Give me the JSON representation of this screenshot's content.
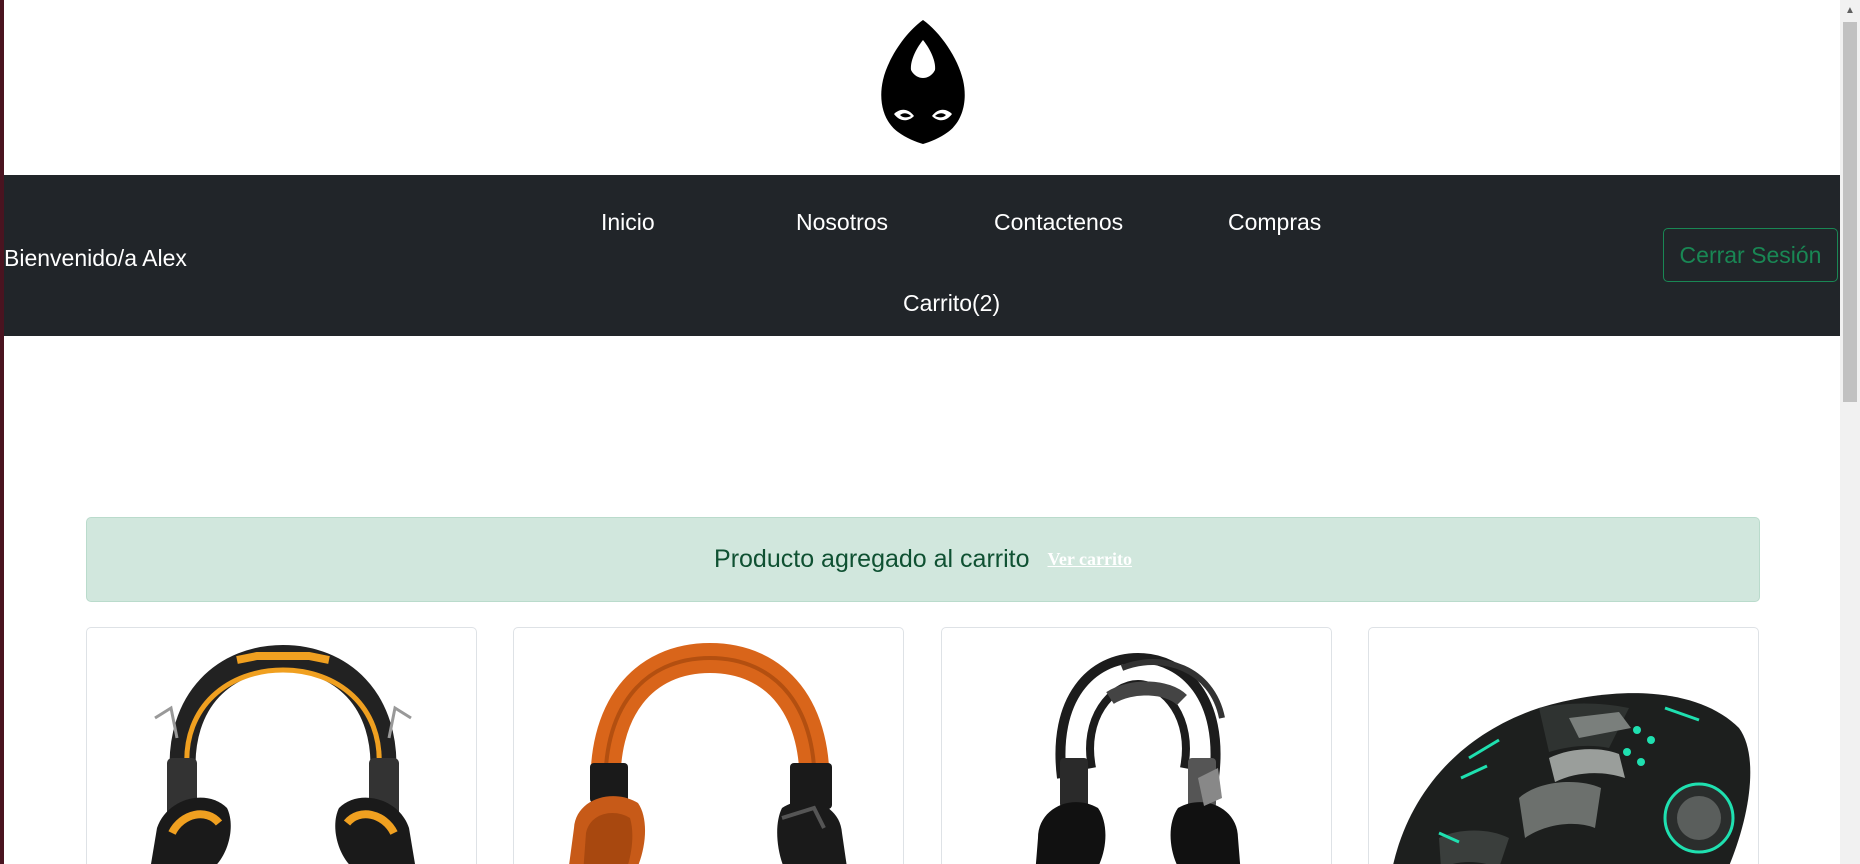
{
  "brand": {
    "logo_icon": "cat-mask-logo-icon"
  },
  "navbar": {
    "welcome": "Bienvenido/a Alex",
    "links": {
      "inicio": "Inicio",
      "nosotros": "Nosotros",
      "contactenos": "Contactenos",
      "compras": "Compras",
      "carrito": "Carrito(2)"
    },
    "logout_label": "Cerrar Sesión"
  },
  "alert": {
    "message": "Producto agregado al carrito",
    "link": "Ver carrito"
  },
  "products": [
    {
      "image": "headset-black-yellow"
    },
    {
      "image": "headset-orange"
    },
    {
      "image": "headset-black-rgb"
    },
    {
      "image": "gaming-mouse-black"
    }
  ],
  "colors": {
    "navbar_bg": "#212529",
    "accent_green": "#198754",
    "alert_bg": "#d1e7dd",
    "alert_text": "#0f5132"
  }
}
